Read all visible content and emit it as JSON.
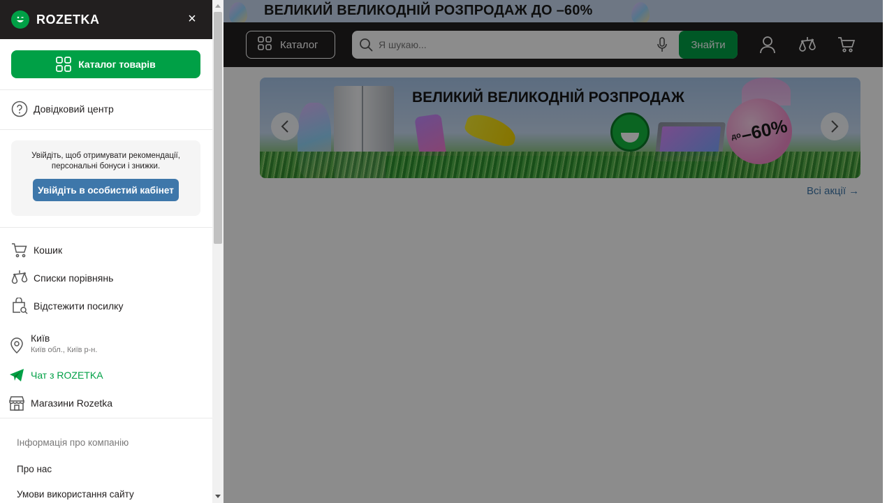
{
  "page": {
    "promo_strip_text": "ВЕЛИКИЙ ВЕЛИКОДНІЙ РОЗПРОДАЖ ДО –60%",
    "header": {
      "catalog_label": "Каталог",
      "search_placeholder": "Я шукаю...",
      "search_button": "Знайти",
      "icons": [
        "user-icon",
        "compare-icon",
        "cart-icon"
      ]
    },
    "hero_banner": {
      "title": "ВЕЛИКИЙ ВЕЛИКОДНІЙ РОЗПРОДАЖ",
      "badge_prefix": "до",
      "badge_value": "–60%"
    },
    "all_promos_link": "Всі акції →"
  },
  "drawer": {
    "logo_text": "ROZETKA",
    "close_label": "×",
    "catalog_button": "Каталог товарів",
    "help_center": "Довідковий центр",
    "login_card": {
      "message": "Увійдіть, щоб отримувати рекомендації, персональні бонуси і знижки.",
      "button": "Увійдіть в особистий кабінет"
    },
    "items": {
      "cart": "Кошик",
      "compare": "Списки порівнянь",
      "track": "Відстежити посилку"
    },
    "location": {
      "city": "Київ",
      "region": "Київ обл., Київ р-н."
    },
    "chat": "Чат з ROZETKA",
    "stores": "Магазини Rozetka",
    "info_title": "Інформація про компанію",
    "links": {
      "about": "Про нас",
      "terms": "Умови використання сайту"
    }
  },
  "colors": {
    "brand_green": "#00a046",
    "header_dark": "#221f1f",
    "link_blue": "#3e77aa",
    "overlay": "rgba(0,0,0,0.45)"
  }
}
